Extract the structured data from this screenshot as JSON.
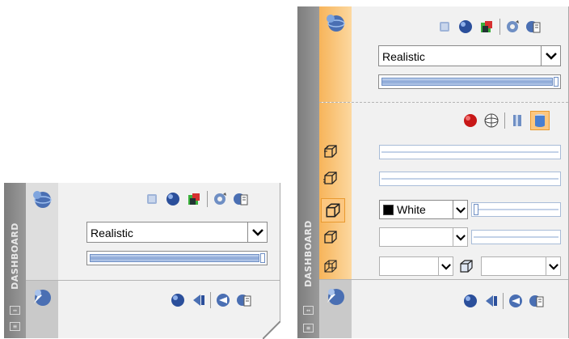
{
  "dashboard_title": "DASHBOARD",
  "left_panel": {
    "visual_style_value": "Realistic",
    "strip_buttons": [
      "|◂▸",
      "▤"
    ]
  },
  "right_panel": {
    "visual_style_value": "Realistic",
    "face_color_value": "White",
    "strip_buttons": [
      "|◂▸",
      "▤"
    ]
  },
  "icons": {
    "visual_styles_row": [
      "visual-style-box-icon",
      "realistic-sphere-icon",
      "color-cube-icon",
      "edit-style-gear-icon",
      "visual-styles-manager-icon"
    ],
    "materials_row": [
      "render-sphere-icon",
      "navigate-icon",
      "render-manager-icon",
      "render-settings-icon"
    ],
    "lighting_row": [
      "red-material-sphere-icon",
      "wire-globe-icon",
      "opacity-cylinder-icon",
      "shaded-cylinder-icon"
    ],
    "edge_rows": [
      "edge-cube-icon",
      "edge-jitter-icon",
      "face-cube-icon",
      "face-cube-alt-icon",
      "perspective-cube-icon",
      "solid-cube-icon"
    ]
  },
  "colors": {
    "orange_gutter": "#f7b45a",
    "panel_bg": "#f1f1f1",
    "strip": "#8c8c8c"
  }
}
